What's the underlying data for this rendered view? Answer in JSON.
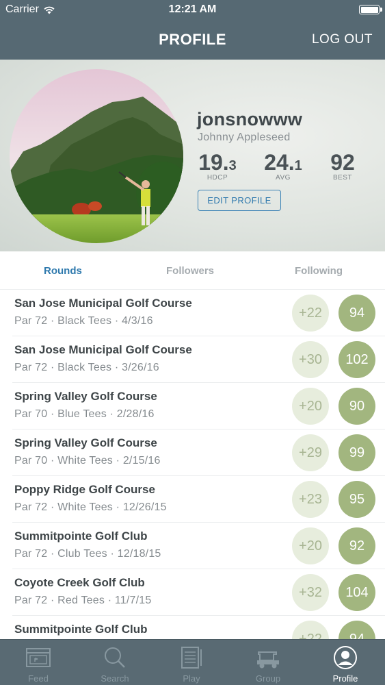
{
  "status_bar": {
    "carrier": "Carrier",
    "time": "12:21 AM"
  },
  "nav": {
    "title": "PROFILE",
    "logout": "LOG OUT"
  },
  "profile": {
    "username": "jonsnowww",
    "full_name": "Johnny Appleseed",
    "stats": [
      {
        "whole": "19.",
        "decimal": "3",
        "label": "HDCP"
      },
      {
        "whole": "24.",
        "decimal": "1",
        "label": "AVG"
      },
      {
        "whole": "92",
        "decimal": "",
        "label": "BEST"
      }
    ],
    "edit_button": "EDIT PROFILE"
  },
  "tabs": [
    {
      "label": "Rounds",
      "active": true
    },
    {
      "label": "Followers",
      "active": false
    },
    {
      "label": "Following",
      "active": false
    }
  ],
  "rounds": [
    {
      "course": "San Jose Municipal Golf Course",
      "meta": "Par 72 · Black Tees · 4/3/16",
      "diff": "+22",
      "score": "94"
    },
    {
      "course": "San Jose Municipal Golf Course",
      "meta": "Par 72 · Black Tees · 3/26/16",
      "diff": "+30",
      "score": "102"
    },
    {
      "course": "Spring Valley Golf Course",
      "meta": "Par 70 · Blue Tees · 2/28/16",
      "diff": "+20",
      "score": "90"
    },
    {
      "course": "Spring Valley Golf Course",
      "meta": "Par 70 · White Tees · 2/15/16",
      "diff": "+29",
      "score": "99"
    },
    {
      "course": "Poppy Ridge Golf Course",
      "meta": "Par 72 · White Tees · 12/26/15",
      "diff": "+23",
      "score": "95"
    },
    {
      "course": "Summitpointe Golf Club",
      "meta": "Par 72 · Club Tees · 12/18/15",
      "diff": "+20",
      "score": "92"
    },
    {
      "course": "Coyote Creek Golf Club",
      "meta": "Par 72 · Red Tees · 11/7/15",
      "diff": "+32",
      "score": "104"
    },
    {
      "course": "Summitpointe Golf Club",
      "meta": "",
      "diff": "+22",
      "score": "94"
    }
  ],
  "tabbar": [
    {
      "label": "Feed",
      "icon": "feed-icon",
      "active": false
    },
    {
      "label": "Search",
      "icon": "search-icon",
      "active": false
    },
    {
      "label": "Play",
      "icon": "scorecard-icon",
      "active": false
    },
    {
      "label": "Group",
      "icon": "golf-cart-icon",
      "active": false
    },
    {
      "label": "Profile",
      "icon": "profile-icon",
      "active": true
    }
  ],
  "colors": {
    "header": "#566973",
    "accent": "#2e79ad",
    "score_fill": "#a2b67f",
    "diff_fill": "#e7eddd",
    "tabbar": "#596a73"
  }
}
